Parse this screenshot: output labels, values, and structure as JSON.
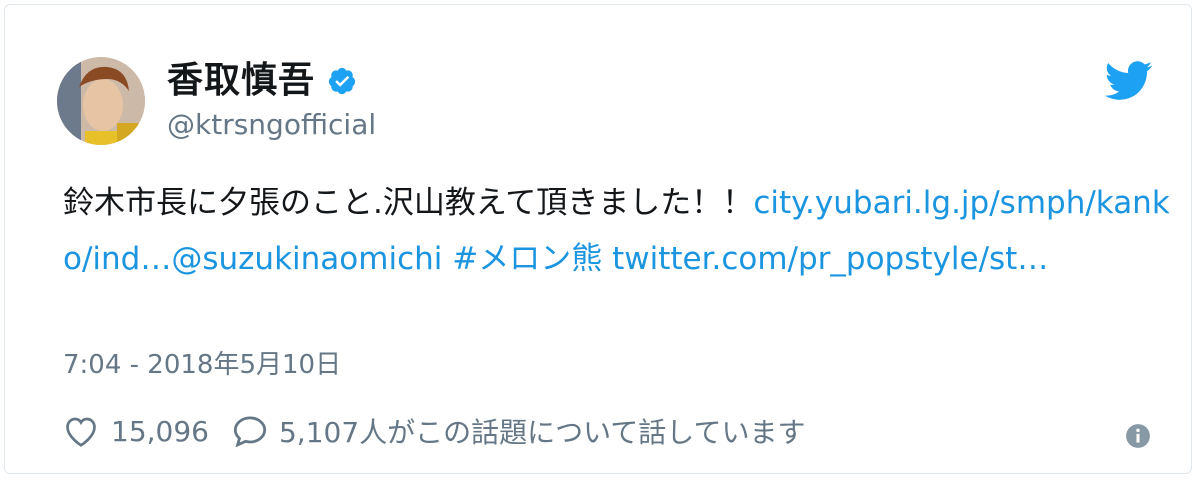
{
  "tweet": {
    "author": {
      "display_name": "香取慎吾",
      "handle": "@ktrsngofficial",
      "verified": true
    },
    "text": {
      "body": "鈴木市長に夕張のこと.沢山教えて頂きました！！",
      "link_url": "city.yubari.lg.jp/smph/kanko/ind…",
      "mention": "@suzukinaomichi",
      "hashtag": "#メロン熊",
      "link_twitter": "twitter.com/pr_popstyle/st…"
    },
    "timestamp": "7:04 - 2018年5月10日",
    "likes": "15,096",
    "replies_text": "5,107人がこの話題について話しています"
  },
  "icons": {
    "brand": "twitter-bird-icon",
    "verified": "verified-badge-icon",
    "like": "heart-icon",
    "reply": "speech-bubble-icon",
    "info": "info-icon"
  },
  "colors": {
    "link": "#1b95e0",
    "twitter_blue": "#1da1f2",
    "muted_text": "#657786",
    "border": "#e1e8ed"
  }
}
